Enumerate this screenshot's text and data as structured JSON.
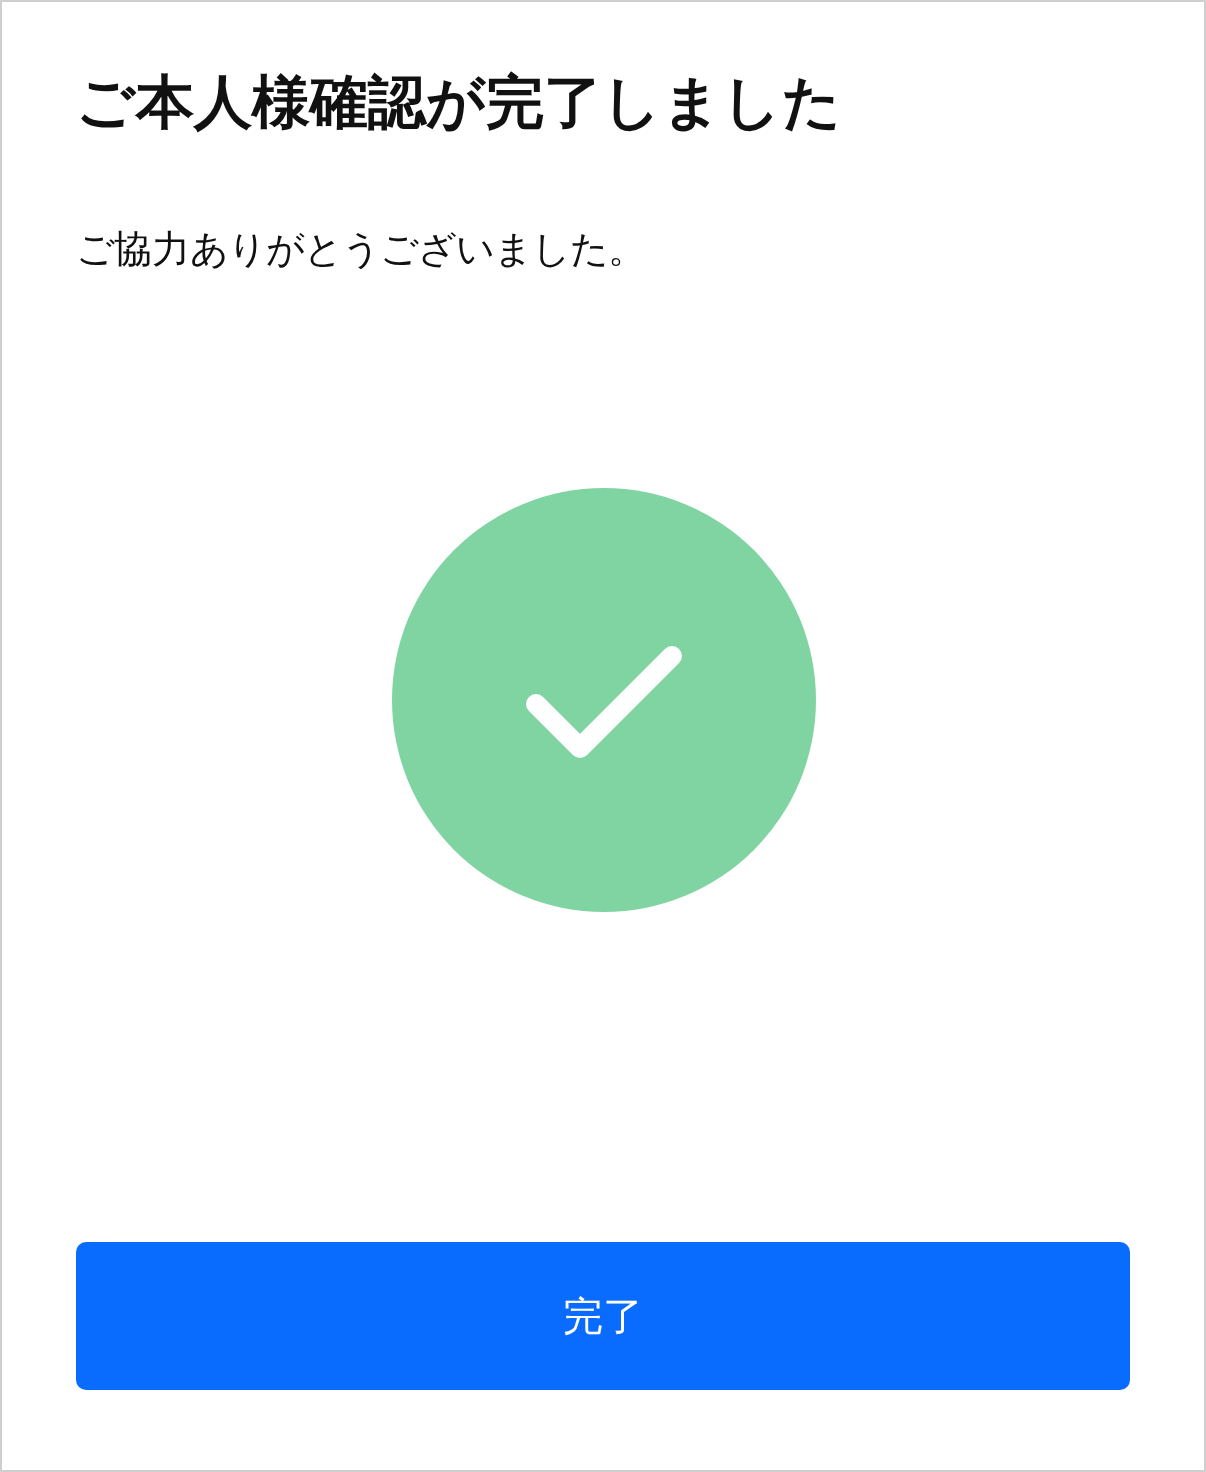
{
  "title": "ご本人様確認が完了しました",
  "message": "ご協力ありがとうございました。",
  "status": {
    "kind": "success"
  },
  "button": {
    "label": "完了"
  }
}
